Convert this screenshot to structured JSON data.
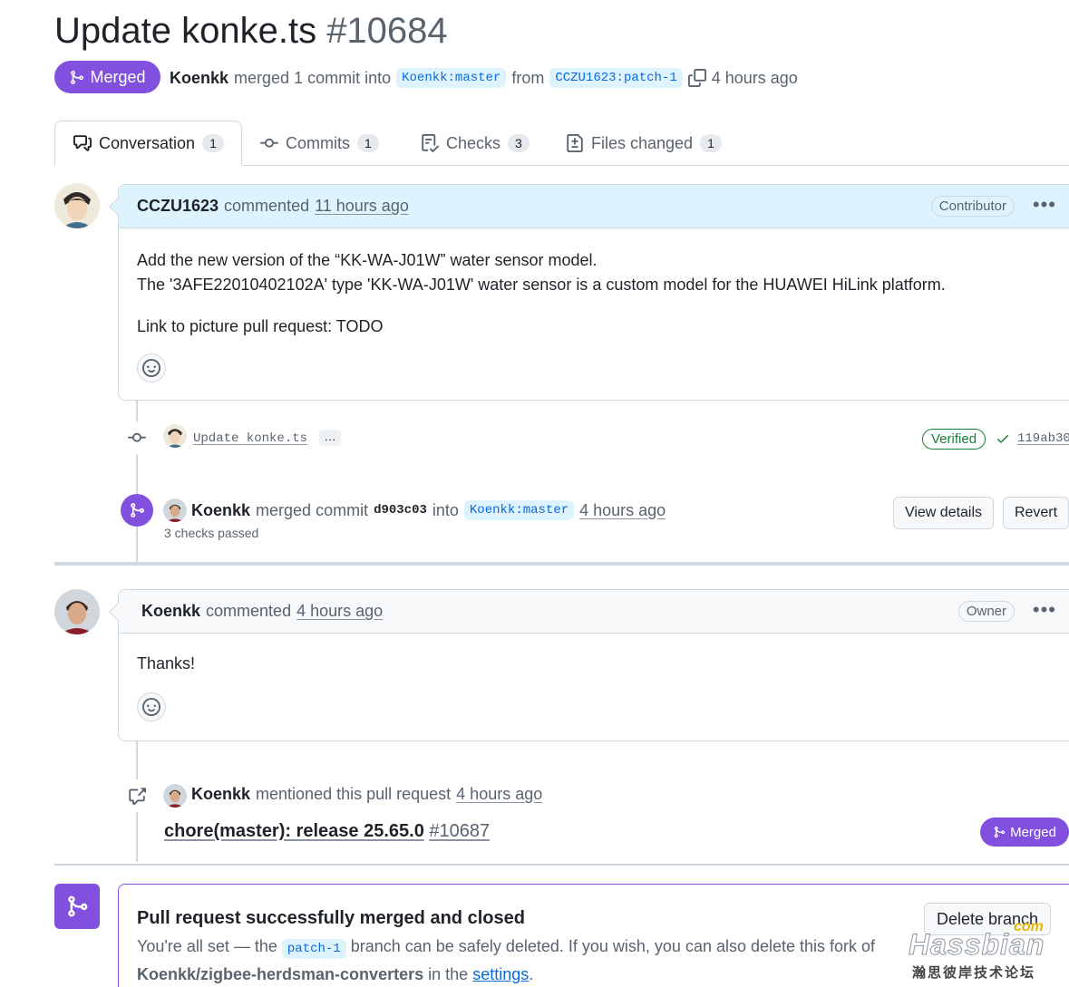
{
  "header": {
    "title": "Update konke.ts",
    "number": "#10684",
    "state": "Merged",
    "author": "Koenkk",
    "action": "merged 1 commit into",
    "base_branch": "Koenkk:master",
    "from": "from",
    "head_branch": "CCZU1623:patch-1",
    "time": "4 hours ago"
  },
  "tabs": [
    {
      "label": "Conversation",
      "count": "1",
      "icon": "comment-discussion-icon"
    },
    {
      "label": "Commits",
      "count": "1",
      "icon": "git-commit-icon"
    },
    {
      "label": "Checks",
      "count": "3",
      "icon": "checklist-icon"
    },
    {
      "label": "Files changed",
      "count": "1",
      "icon": "file-diff-icon"
    }
  ],
  "comment1": {
    "author": "CCZU1623",
    "verb": "commented",
    "time": "11 hours ago",
    "role": "Contributor",
    "menu": "•••",
    "line1": "Add the new version of the “KK-WA-J01W” water sensor model.",
    "line2": "The '3AFE22010402102A' type 'KK-WA-J01W' water sensor is a custom model for the HUAWEI HiLink platform.",
    "line3": "Link to picture pull request: TODO"
  },
  "commit": {
    "message": "Update konke.ts",
    "ellipsis": "…",
    "verified": "Verified",
    "sha": "119ab30"
  },
  "merge_event": {
    "author": "Koenkk",
    "verb": "merged commit",
    "sha": "d903c03",
    "into": "into",
    "branch": "Koenkk:master",
    "time": "4 hours ago",
    "checks": "3 checks passed",
    "view_details": "View details",
    "revert": "Revert"
  },
  "comment2": {
    "author": "Koenkk",
    "verb": "commented",
    "time": "4 hours ago",
    "role": "Owner",
    "menu": "•••",
    "body": "Thanks!"
  },
  "mention": {
    "author": "Koenkk",
    "verb": "mentioned this pull request",
    "time": "4 hours ago",
    "pr_title": "chore(master): release 25.65.0",
    "pr_number": "#10687",
    "state": "Merged"
  },
  "merged_box": {
    "title": "Pull request successfully merged and closed",
    "text1": "You're all set — the",
    "branch": "patch-1",
    "text2": "branch can be safely deleted. If you wish, you can also delete this fork of",
    "repo": "Koenkk/zigbee-herdsman-converters",
    "text3": "in the",
    "settings": "settings",
    "period": ".",
    "delete_button": "Delete branch"
  },
  "watermark": {
    "brand": "Hassbian",
    "suffix": "com",
    "subtitle": "瀚思彼岸技术论坛"
  },
  "colors": {
    "merged_purple": "#8250df",
    "link_blue": "#0969da",
    "branch_bg": "#ddf4ff",
    "comment_header_bg": "#ddf4ff",
    "verified_green": "#1a7f37"
  }
}
